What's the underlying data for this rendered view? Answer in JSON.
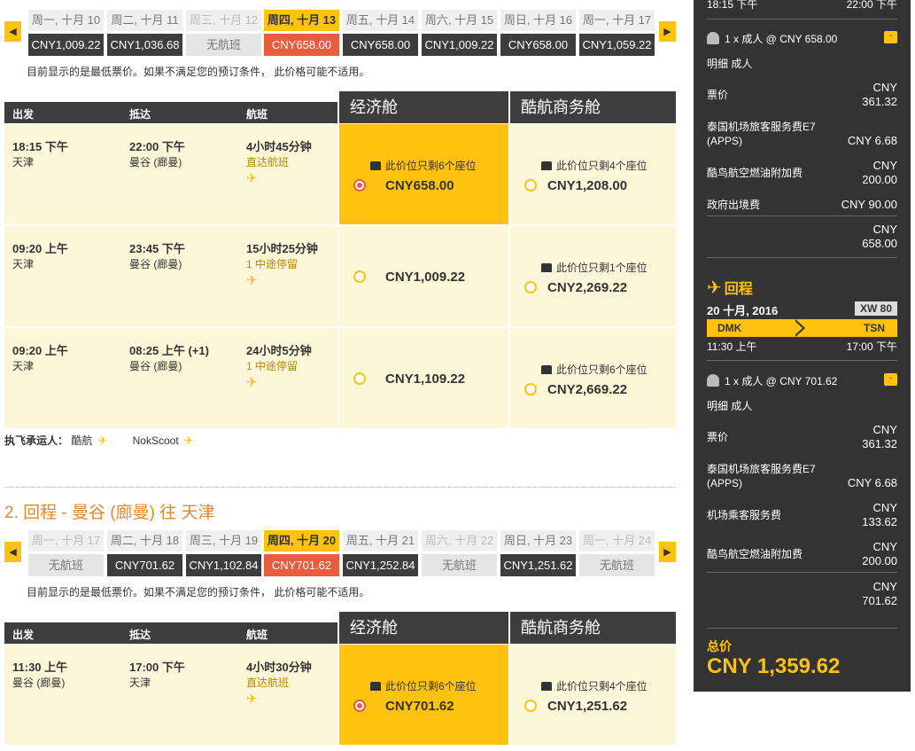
{
  "outbound": {
    "date_strip": [
      {
        "label": "周一, 十月 10",
        "price": "CNY1,009.22",
        "state": "normal"
      },
      {
        "label": "周二, 十月 11",
        "price": "CNY1,036.68",
        "state": "normal"
      },
      {
        "label": "周三, 十月 12",
        "price": "无航班",
        "state": "disabled"
      },
      {
        "label": "周四, 十月 13",
        "price": "CNY658.00",
        "state": "selected"
      },
      {
        "label": "周五, 十月 14",
        "price": "CNY658.00",
        "state": "normal"
      },
      {
        "label": "周六, 十月 15",
        "price": "CNY1,009.22",
        "state": "normal"
      },
      {
        "label": "周日, 十月 16",
        "price": "CNY658.00",
        "state": "normal"
      },
      {
        "label": "周一, 十月 17",
        "price": "CNY1,059.22",
        "state": "normal"
      }
    ],
    "notice": "目前显示的是最低票价。如果不满足您的预订条件， 此价格可能不适用。",
    "headers": {
      "depart": "出发",
      "arrive": "抵达",
      "flight": "航班",
      "economy": "经济舱",
      "business": "酷航商务舱"
    },
    "rows": [
      {
        "dep_time": "18:15 下午",
        "dep_city": "天津",
        "arr_time": "22:00 下午",
        "arr_city": "曼谷 (廊曼)",
        "duration": "4小时45分钟",
        "stops": "直达航班",
        "eco_seats": "此价位只剩6个座位",
        "eco_price": "CNY658.00",
        "eco_selected": true,
        "biz_seats": "此价位只剩4个座位",
        "biz_price": "CNY1,208.00"
      },
      {
        "dep_time": "09:20 上午",
        "dep_city": "天津",
        "arr_time": "23:45 下午",
        "arr_city": "曼谷 (廊曼)",
        "duration": "15小时25分钟",
        "stops": "1 中途停留",
        "eco_seats": "",
        "eco_price": "CNY1,009.22",
        "eco_selected": false,
        "biz_seats": "此价位只剩1个座位",
        "biz_price": "CNY2,269.22"
      },
      {
        "dep_time": "09:20 上午",
        "dep_city": "天津",
        "arr_time": "08:25 上午 (+1)",
        "arr_city": "曼谷 (廊曼)",
        "duration": "24小时5分钟",
        "stops": "1 中途停留",
        "eco_seats": "",
        "eco_price": "CNY1,109.22",
        "eco_selected": false,
        "biz_seats": "此价位只剩6个座位",
        "biz_price": "CNY2,669.22"
      }
    ],
    "carriers_label": "执飞承运人：",
    "carriers": [
      "酷航",
      "NokScoot"
    ]
  },
  "return_section": {
    "title": "2. 回程 - 曼谷 (廊曼) 往 天津",
    "date_strip": [
      {
        "label": "周一, 十月 17",
        "price": "无航班",
        "state": "disabled"
      },
      {
        "label": "周二, 十月 18",
        "price": "CNY701.62",
        "state": "normal"
      },
      {
        "label": "周三, 十月 19",
        "price": "CNY1,102.84",
        "state": "normal"
      },
      {
        "label": "周四, 十月 20",
        "price": "CNY701.62",
        "state": "selected"
      },
      {
        "label": "周五, 十月 21",
        "price": "CNY1,252.84",
        "state": "normal"
      },
      {
        "label": "周六, 十月 22",
        "price": "无航班",
        "state": "disabled"
      },
      {
        "label": "周日, 十月 23",
        "price": "CNY1,251.62",
        "state": "normal"
      },
      {
        "label": "周一, 十月 24",
        "price": "无航班",
        "state": "disabled"
      }
    ],
    "notice": "目前显示的是最低票价。如果不满足您的预订条件， 此价格可能不适用。",
    "headers": {
      "depart": "出发",
      "arrive": "抵达",
      "flight": "航班",
      "economy": "经济舱",
      "business": "酷航商务舱"
    },
    "rows": [
      {
        "dep_time": "11:30 上午",
        "dep_city": "曼谷 (廊曼)",
        "arr_time": "17:00 下午",
        "arr_city": "天津",
        "duration": "4小时30分钟",
        "stops": "直达航班",
        "eco_seats": "此价位只剩6个座位",
        "eco_price": "CNY701.62",
        "eco_selected": true,
        "biz_seats": "此价位只剩4个座位",
        "biz_price": "CNY1,251.62"
      }
    ]
  },
  "icons": {
    "prev": "chevron-left-icon",
    "next": "chevron-right-icon",
    "seat": "seat-icon",
    "plane": "plane-icon",
    "passenger": "passenger-icon",
    "toggle": "minus-icon"
  },
  "colors": {
    "accent": "#ffc20e",
    "selected_price": "#e95c3f",
    "dark": "#3d3d3d",
    "row_bg": "#fdf7d9",
    "section_title": "#e0892d"
  },
  "sidebar": {
    "top_dep_time": "18:15 下午",
    "top_arr_time": "22:00 下午",
    "outbound_pax": {
      "line": "1 x 成人 @ CNY 658.00",
      "detail": "明细 成人",
      "items": [
        {
          "label": "票价",
          "value": "CNY\n361.32"
        },
        {
          "label": "泰国机场旅客服务费E7\n(APPS)",
          "value": "CNY 6.68"
        },
        {
          "label": "酷鸟航空燃油附加费",
          "value": "CNY\n200.00"
        },
        {
          "label": "政府出境费",
          "value": "CNY 90.00"
        }
      ],
      "subtotal": "CNY\n658.00"
    },
    "return_label": "回程",
    "return_date": "20 十月, 2016",
    "return_flight_no": "XW 80",
    "route_from": "DMK",
    "route_to": "TSN",
    "route_dep_time": "11:30 上午",
    "route_arr_time": "17:00 下午",
    "return_pax": {
      "line": "1 x 成人 @ CNY 701.62",
      "detail": "明细 成人",
      "items": [
        {
          "label": "票价",
          "value": "CNY\n361.32"
        },
        {
          "label": "泰国机场旅客服务费E7\n(APPS)",
          "value": "CNY 6.68"
        },
        {
          "label": "机场乘客服务费",
          "value": "CNY\n133.62"
        },
        {
          "label": "酷鸟航空燃油附加费",
          "value": "CNY\n200.00"
        }
      ],
      "subtotal": "CNY\n701.62"
    },
    "total_label": "总价",
    "total_value": "CNY 1,359.62"
  }
}
